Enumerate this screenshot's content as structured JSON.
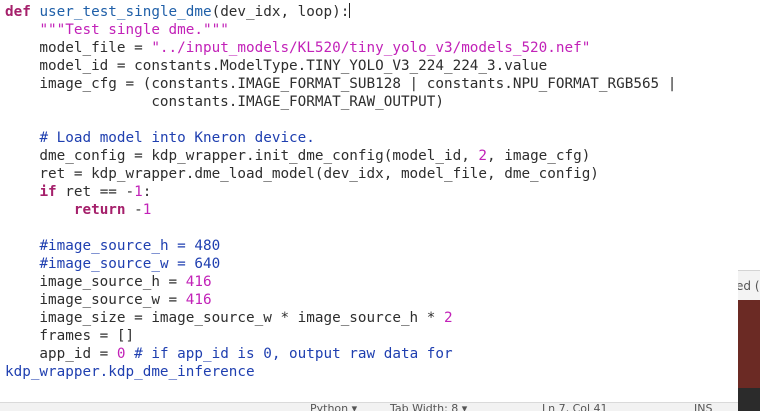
{
  "editor": {
    "lines": [
      [
        [
          "kw",
          "def"
        ],
        [
          "txt",
          " "
        ],
        [
          "fn",
          "user_test_single_dme"
        ],
        [
          "txt",
          "(dev_idx, loop):"
        ]
      ],
      [
        [
          "txt",
          "    "
        ],
        [
          "str",
          "\"\"\"Test single dme.\"\"\""
        ]
      ],
      [
        [
          "txt",
          "    model_file = "
        ],
        [
          "str",
          "\"../input_models/KL520/tiny_yolo_v3/models_520.nef\""
        ]
      ],
      [
        [
          "txt",
          "    model_id = constants.ModelType.TINY_YOLO_V3_224_224_3.value"
        ]
      ],
      [
        [
          "txt",
          "    image_cfg = (constants.IMAGE_FORMAT_SUB128 | constants.NPU_FORMAT_RGB565 |"
        ]
      ],
      [
        [
          "txt",
          "                 constants.IMAGE_FORMAT_RAW_OUTPUT)"
        ]
      ],
      [],
      [
        [
          "txt",
          "    "
        ],
        [
          "cmt",
          "# Load model into Kneron device."
        ]
      ],
      [
        [
          "txt",
          "    dme_config = kdp_wrapper.init_dme_config(model_id, "
        ],
        [
          "num",
          "2"
        ],
        [
          "txt",
          ", image_cfg)"
        ]
      ],
      [
        [
          "txt",
          "    ret = kdp_wrapper.dme_load_model(dev_idx, model_file, dme_config)"
        ]
      ],
      [
        [
          "txt",
          "    "
        ],
        [
          "kw",
          "if"
        ],
        [
          "txt",
          " ret == -"
        ],
        [
          "num",
          "1"
        ],
        [
          "txt",
          ":"
        ]
      ],
      [
        [
          "txt",
          "        "
        ],
        [
          "kw",
          "return"
        ],
        [
          "txt",
          " -"
        ],
        [
          "num",
          "1"
        ]
      ],
      [],
      [
        [
          "txt",
          "    "
        ],
        [
          "cmt",
          "#image_source_h = 480"
        ]
      ],
      [
        [
          "txt",
          "    "
        ],
        [
          "cmt",
          "#image_source_w = 640"
        ]
      ],
      [
        [
          "txt",
          "    image_source_h = "
        ],
        [
          "num",
          "416"
        ]
      ],
      [
        [
          "txt",
          "    image_source_w = "
        ],
        [
          "num",
          "416"
        ]
      ],
      [
        [
          "txt",
          "    image_size = image_source_w * image_source_h * "
        ],
        [
          "num",
          "2"
        ]
      ],
      [
        [
          "txt",
          "    frames = []"
        ]
      ],
      [
        [
          "txt",
          "    app_id = "
        ],
        [
          "num",
          "0"
        ],
        [
          "txt",
          " "
        ],
        [
          "cmt",
          "# if app_id is 0, output raw data for"
        ]
      ],
      [
        [
          "cmt",
          "kdp_wrapper.kdp_dme_inference"
        ]
      ]
    ]
  },
  "statusbar": {
    "language": "Python ▾",
    "tab_width": "Tab Width: 8 ▾",
    "position": "Ln 7, Col 41",
    "mode": "INS"
  },
  "side_panel": {
    "partial_text": "ed ("
  },
  "colors": {
    "keyword": "#a5206b",
    "function": "#1f5fa8",
    "string": "#c222b8",
    "comment": "#1f3fb0"
  }
}
